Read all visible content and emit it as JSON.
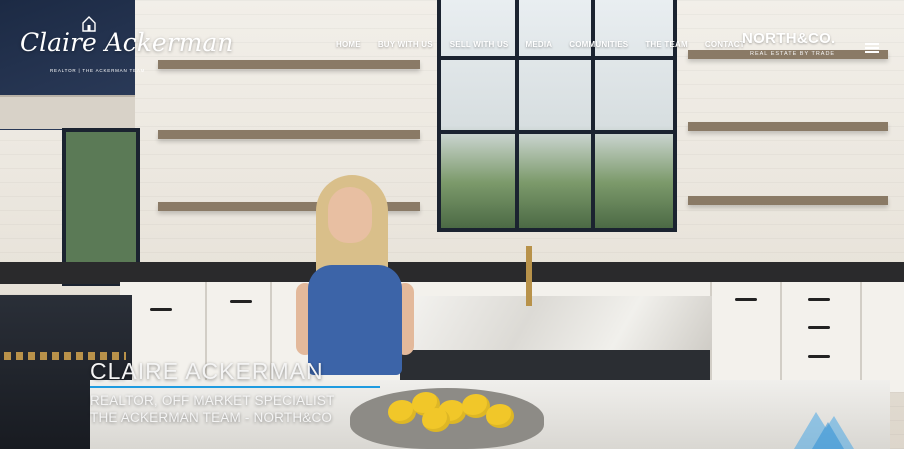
{
  "header": {
    "logo": {
      "script": "Claire Ackerman",
      "subtitle": "REALTOR | THE ACKERMAN TEAM"
    },
    "nav": [
      {
        "label": "HOME"
      },
      {
        "label": "BUY WITH US"
      },
      {
        "label": "SELL WITH US"
      },
      {
        "label": "MEDIA"
      },
      {
        "label": "COMMUNITIES"
      },
      {
        "label": "THE TEAM"
      },
      {
        "label": "CONTACT"
      }
    ],
    "brand": {
      "name": "NORTH&CO.",
      "tagline": "REAL ESTATE BY TRADE"
    },
    "menu_icon": "hamburger-menu-icon"
  },
  "video": {
    "lower_third": {
      "name": "CLAIRE ACKERMAN",
      "title": "REALTOR, OFF MARKET SPECIALIST",
      "team": "THE ACKERMAN TEAM - NORTH&CO"
    },
    "accent_color": "#1f9be0",
    "watermark_icon": "brand-watermark-icon"
  }
}
